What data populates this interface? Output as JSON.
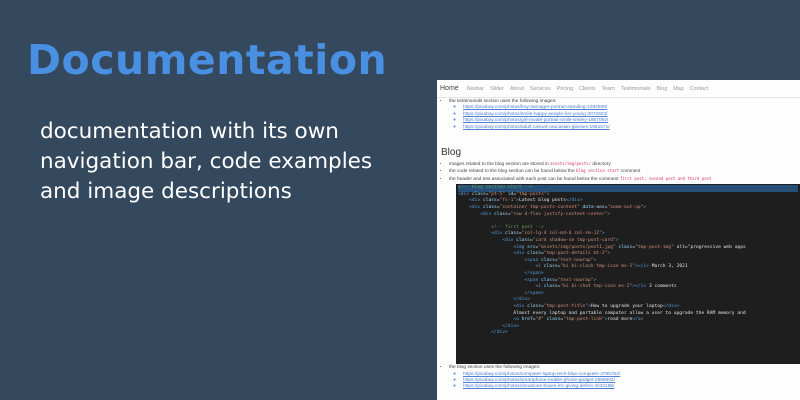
{
  "hero": {
    "title": "Documentation",
    "description": "documentation with its own navigation bar, code examples and image descriptions"
  },
  "screenshot": {
    "nav": [
      {
        "label": "Home"
      },
      {
        "label": "Navbar"
      },
      {
        "label": "Slider"
      },
      {
        "label": "About"
      },
      {
        "label": "Services"
      },
      {
        "label": "Pricing"
      },
      {
        "label": "Clients"
      },
      {
        "label": "Team"
      },
      {
        "label": "Testimonials"
      },
      {
        "label": "Blog"
      },
      {
        "label": "Map"
      },
      {
        "label": "Contact"
      }
    ],
    "testimonials": {
      "intro": "the testimonials section uses the following images:",
      "links": [
        "https://pixabay.com/photos/boy-teenager-portrait-standing-1284509/",
        "https://pixabay.com/photos/smile-happy-people-fun-young-3072603/",
        "https://pixabay.com/photos/girl-model-portrait-smile-smiley-1867092/",
        "https://pixabay.com/photos/adult-casual-caucasian-glasses-1851571/"
      ]
    },
    "blog": {
      "title": "Blog",
      "bullets": [
        {
          "pre": "images related to the blog section are stored in ",
          "code": "assets/img/posts/",
          "post": " directory"
        },
        {
          "pre": "the code related to the blog section can be found below the ",
          "code": "blog section start",
          "post": " comment"
        },
        {
          "pre": "the header and text associated with each post can be found below the comment ",
          "code": "first post, second post and third post",
          "post": ""
        }
      ],
      "code_lines": [
        "<!-- blog section start -->",
        "<div class=\"pt-5\" id=\"tmp-posts\">",
        "    <div class=\"fs-1\">Latest blog posts</div>",
        "    <div class=\"container tmp-posts-content\" data-aos=\"zoom-out-up\">",
        "        <div class=\"row d-flex justify-content-center\">",
        "",
        "            <!-- first post -->",
        "            <div class=\"col-lg-4 col-md-6 col-sm-12\">",
        "                <div class=\"card shadow-sm tmp-post-card\">",
        "                    <img src=\"assets/img/posts/post1.jpg\" class=\"tmp-post-img\" alt=\"progressive web apps",
        "                    <div class=\"tmp-post-details mt-2\">",
        "                        <span class=\"text-nowrap\">",
        "                            <i class=\"bi bi-clock tmp-icon ms-2\"></i> March 3, 2021",
        "                        </span>",
        "                        <span class=\"text-nowrap\">",
        "                            <i class=\"bi bi-chat tmp-icon ms-2\"></i> 3 comments",
        "                        </span>",
        "                    </div>",
        "                    <div class=\"tmp-post-title\">How to upgrade your laptop</div>",
        "                    Almost every laptop and portable computer allow a user to upgrade the RAM memory and",
        "                    <a href=\"#\" class=\"tmp-post-link\">read more</a>",
        "                </div>",
        "            </div>"
      ],
      "images_intro": "the blog section uses the following images:",
      "image_links": [
        "https://pixabay.com/photos/computer-laptop-tech-blue-computer-4795762/",
        "https://pixabay.com/photos/smartphone-mobile-phone-gadget-2566602/",
        "https://pixabay.com/photos/donations-boxes-inc-giving-defect-4242196/"
      ]
    }
  }
}
